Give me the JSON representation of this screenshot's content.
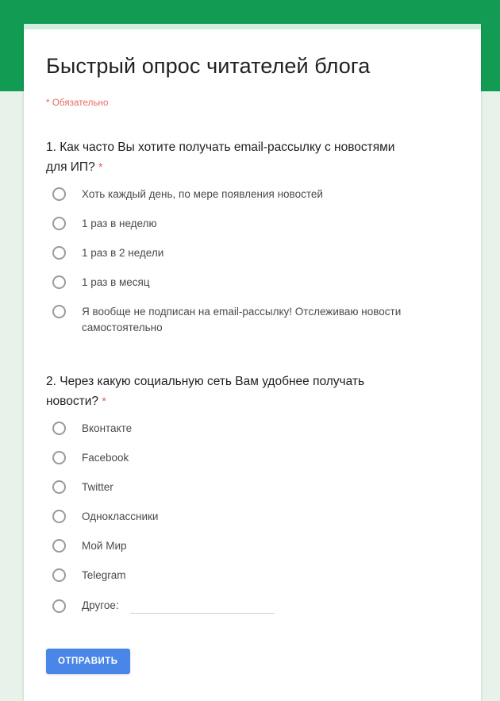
{
  "theme": {
    "header_green": "#129b53",
    "page_background": "#e6f2ea",
    "card_accent": "#cfeedd",
    "submit_blue": "#4a86e8",
    "required_red": "#d93025"
  },
  "form": {
    "title": "Быстрый опрос читателей блога",
    "required_note": "* Обязательно",
    "required_marker": "*"
  },
  "questions": [
    {
      "title": "1. Как часто Вы хотите получать email-рассылку с новостями для ИП?",
      "required": true,
      "options": [
        {
          "label": "Хоть каждый день, по мере появления новостей"
        },
        {
          "label": "1 раз в неделю"
        },
        {
          "label": "1 раз в 2 недели"
        },
        {
          "label": "1 раз в месяц"
        },
        {
          "label": "Я вообще не подписан на email-рассылку! Отслеживаю новости самостоятельно"
        }
      ]
    },
    {
      "title": "2. Через какую социальную сеть Вам удобнее получать новости?",
      "required": true,
      "options": [
        {
          "label": "Вконтакте"
        },
        {
          "label": "Facebook"
        },
        {
          "label": "Twitter"
        },
        {
          "label": "Одноклассники"
        },
        {
          "label": "Мой Мир"
        },
        {
          "label": "Telegram"
        },
        {
          "label": "Другое:",
          "has_text_input": true,
          "input_value": "",
          "input_placeholder": ""
        }
      ]
    }
  ],
  "submit": {
    "label": "ОТПРАВИТЬ"
  }
}
